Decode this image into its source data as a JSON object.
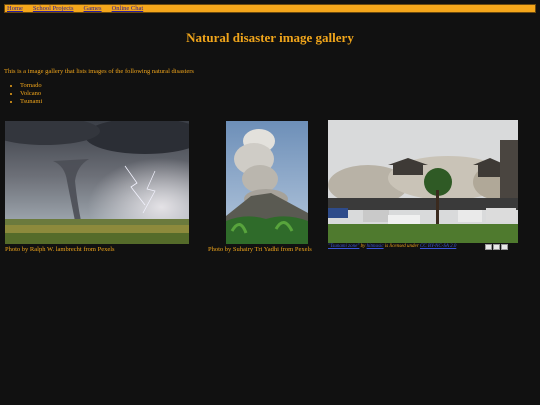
{
  "nav": {
    "items": [
      "Home",
      "School Projects",
      "Games",
      "Online Chat"
    ]
  },
  "page": {
    "title": "Natural disaster image gallery",
    "intro": "This is a image gallery that lists images of the following natural disasters",
    "disasters": [
      "Tornado",
      "Volcano",
      "Tsunami"
    ]
  },
  "gallery": {
    "tornado_caption": "Photo by Ralph W. lambrecht from Pexels",
    "volcano_caption": "Photo by Suhairy Tri Yadhi from Pexels",
    "tsunami_credit": {
      "link1": "\"Tsunami zone\"",
      "by": " by ",
      "link2": "hitmusic",
      "licensed": " is licensed under ",
      "link3": "CC BY-NC-SA 2.0"
    }
  },
  "colors": {
    "background": "#111111",
    "accent": "#f0a51b",
    "nav_bar": "#f4a61b",
    "link": "#2a1d9a"
  }
}
